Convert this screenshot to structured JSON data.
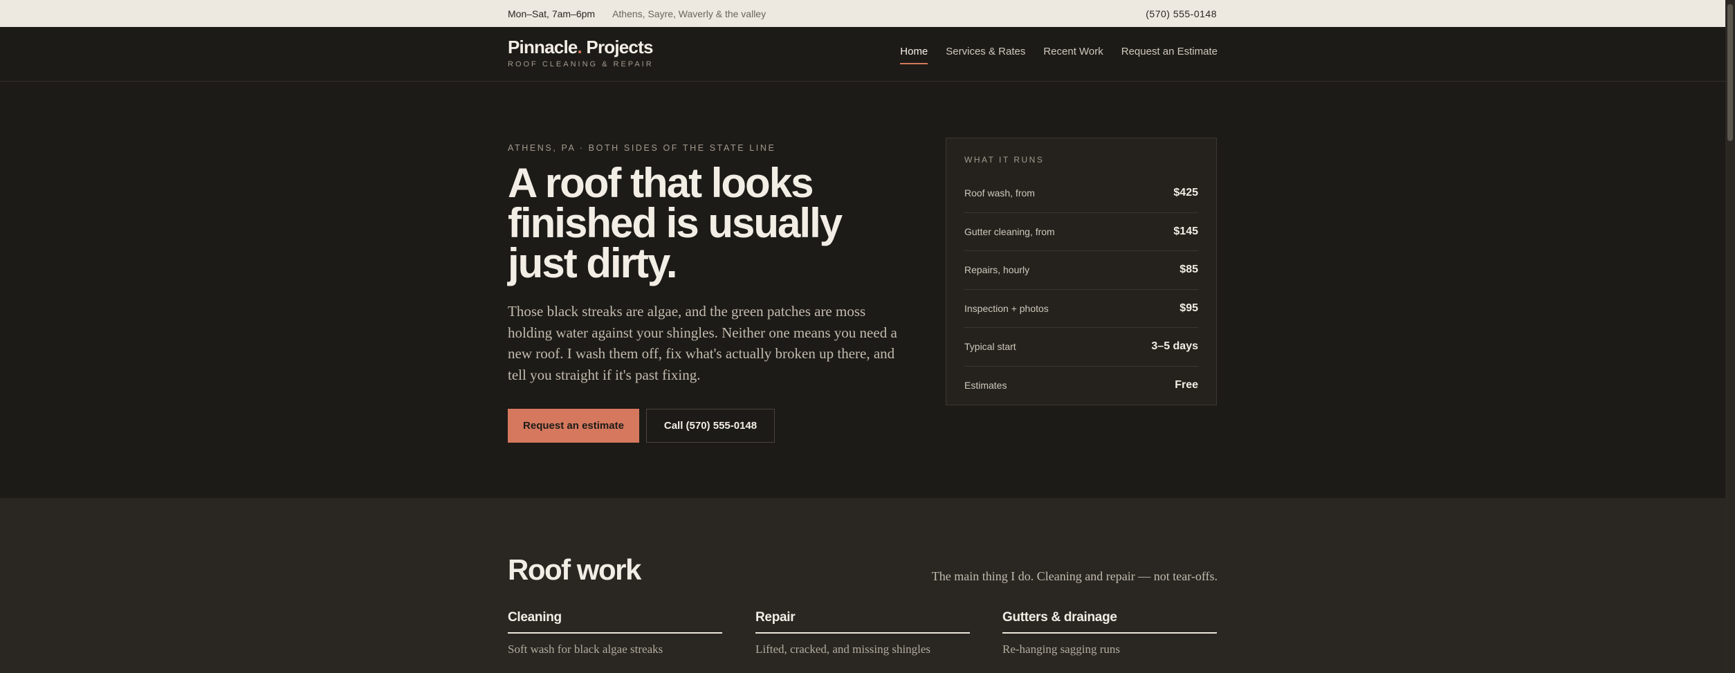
{
  "topbar": {
    "hours": "Mon–Sat, 7am–6pm",
    "areas": "Athens, Sayre, Waverly & the valley",
    "phone": "(570) 555-0148"
  },
  "brand": {
    "name_part1": "Pinnacle",
    "dot": ".",
    "name_part2": " Projects",
    "tagline": "ROOF CLEANING & REPAIR"
  },
  "nav": {
    "items": [
      {
        "label": "Home",
        "active": true
      },
      {
        "label": "Services & Rates"
      },
      {
        "label": "Recent Work"
      },
      {
        "label": "Request an Estimate"
      }
    ]
  },
  "hero": {
    "eyebrow": "ATHENS, PA · BOTH SIDES OF THE STATE LINE",
    "title": "A roof that looks finished is usually just dirty.",
    "body": "Those black streaks are algae, and the green patches are moss holding water against your shingles. Neither one means you need a new roof. I wash them off, fix what's actually broken up there, and tell you straight if it's past fixing.",
    "cta_primary": "Request an estimate",
    "cta_secondary": "Call (570) 555-0148"
  },
  "rates": {
    "title": "WHAT IT RUNS",
    "rows": [
      {
        "label": "Roof wash, from",
        "value": "$425"
      },
      {
        "label": "Gutter cleaning, from",
        "value": "$145"
      },
      {
        "label": "Repairs, hourly",
        "value": "$85"
      },
      {
        "label": "Inspection + photos",
        "value": "$95"
      },
      {
        "label": "Typical start",
        "value": "3–5 days"
      },
      {
        "label": "Estimates",
        "value": "Free"
      }
    ]
  },
  "services": {
    "heading": "Roof work",
    "subheading": "The main thing I do. Cleaning and repair — not tear-offs.",
    "columns": [
      {
        "title": "Cleaning",
        "desc": "Soft wash for black algae streaks"
      },
      {
        "title": "Repair",
        "desc": "Lifted, cracked, and missing shingles"
      },
      {
        "title": "Gutters & drainage",
        "desc": "Re-hanging sagging runs"
      }
    ]
  }
}
